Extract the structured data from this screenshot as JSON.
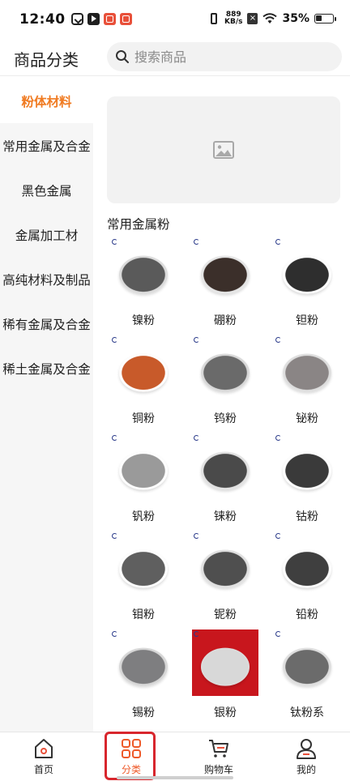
{
  "status_bar": {
    "time": "12:40",
    "net_speed_value": "889",
    "net_speed_unit": "KB/s",
    "battery": "35%",
    "app_icons": [
      "task-app-icon",
      "video-app-icon",
      "red-app-icon",
      "orange-app-icon"
    ]
  },
  "header": {
    "title": "商品分类",
    "search_placeholder": "搜索商品"
  },
  "sidebar": {
    "items": [
      {
        "label": "粉体材料",
        "active": true
      },
      {
        "label": "常用金属及合金",
        "active": false
      },
      {
        "label": "黑色金属",
        "active": false
      },
      {
        "label": "金属加工材",
        "active": false
      },
      {
        "label": "高纯材料及制品",
        "active": false
      },
      {
        "label": "稀有金属及合金",
        "active": false
      },
      {
        "label": "稀土金属及合金",
        "active": false
      }
    ]
  },
  "content": {
    "banner_icon": "image-placeholder-icon",
    "section_title": "常用金属粉",
    "products": [
      {
        "name": "镍粉",
        "powder_color": "#5a5a5a",
        "dish_color": "#d9d9d9"
      },
      {
        "name": "硼粉",
        "powder_color": "#3b2f2a",
        "dish_color": "#e3e3e3"
      },
      {
        "name": "钽粉",
        "powder_color": "#2e2e2e",
        "dish_color": "#ffffff"
      },
      {
        "name": "铜粉",
        "powder_color": "#c85a2a",
        "dish_color": "#ffffff"
      },
      {
        "name": "钨粉",
        "powder_color": "#6a6a6a",
        "dish_color": "#d6d6d6"
      },
      {
        "name": "铋粉",
        "powder_color": "#8a8585",
        "dish_color": "#dcdcdc"
      },
      {
        "name": "钒粉",
        "powder_color": "#9a9a9a",
        "dish_color": "#ffffff"
      },
      {
        "name": "铼粉",
        "powder_color": "#4a4a4a",
        "dish_color": "#e0e0e0"
      },
      {
        "name": "钴粉",
        "powder_color": "#3a3a3a",
        "dish_color": "#ffffff"
      },
      {
        "name": "钼粉",
        "powder_color": "#5f5f5f",
        "dish_color": "#ffffff"
      },
      {
        "name": "铌粉",
        "powder_color": "#4f4f4f",
        "dish_color": "#dedede"
      },
      {
        "name": "铅粉",
        "powder_color": "#3f3f3f",
        "dish_color": "#ffffff"
      },
      {
        "name": "锡粉",
        "powder_color": "#7e7e80",
        "dish_color": "#d4d4d4"
      },
      {
        "name": "银粉",
        "powder_color": "#d8d8d8",
        "dish_color": "#c8161d"
      },
      {
        "name": "钛粉系",
        "powder_color": "#6b6b6b",
        "dish_color": "#dcdcdc"
      }
    ]
  },
  "bottom_nav": {
    "items": [
      {
        "label": "首页",
        "icon": "home-icon",
        "active": false
      },
      {
        "label": "分类",
        "icon": "category-grid-icon",
        "active": true
      },
      {
        "label": "购物车",
        "icon": "cart-icon",
        "active": false
      },
      {
        "label": "我的",
        "icon": "user-icon",
        "active": false
      }
    ],
    "accent_color": "#ee5a2a",
    "highlight_frame_color": "#d8262d"
  },
  "colors": {
    "accent": "#f07b22",
    "sidebar_bg": "#f6f6f6"
  }
}
